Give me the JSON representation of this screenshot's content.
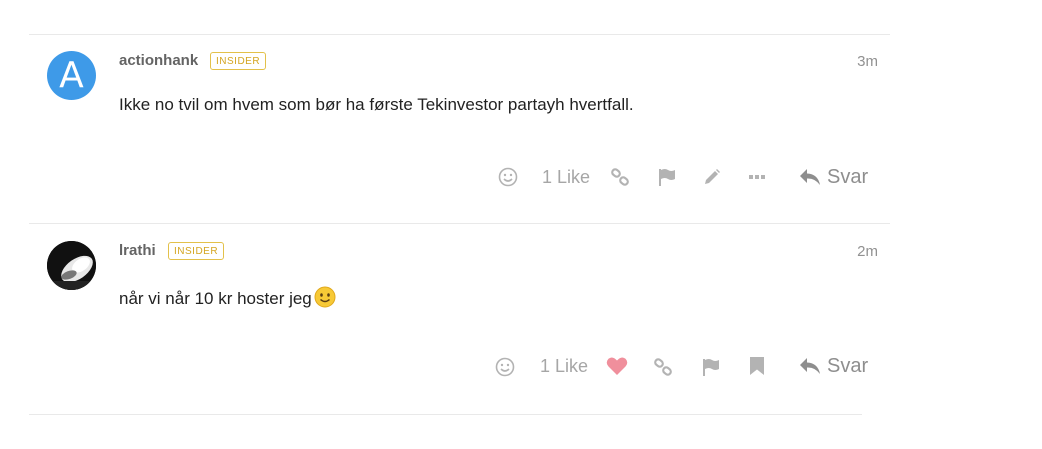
{
  "posts": [
    {
      "username": "actionhank",
      "badge": "INSIDER",
      "time": "3m",
      "avatar_letter": "A",
      "body": "Ikke no tvil om hvem som bør ha første Tekinvestor partayh hvertfall.",
      "likes": "1 Like",
      "reply_label": "Svar",
      "liked": false,
      "actions": [
        "emoji-react-icon",
        "link-icon",
        "flag-icon",
        "edit-icon",
        "more-icon"
      ]
    },
    {
      "username": "lrathi",
      "badge": "INSIDER",
      "time": "2m",
      "body": "når vi når 10 kr hoster jeg",
      "body_emoji": "slightly-smiling-face-icon",
      "likes": "1 Like",
      "reply_label": "Svar",
      "liked": true,
      "actions": [
        "emoji-react-icon",
        "heart-icon",
        "link-icon",
        "flag-icon",
        "bookmark-icon"
      ]
    }
  ],
  "colors": {
    "badge": "#d4a520",
    "heart": "#f08f9c",
    "avatar_blue": "#3e9ae8",
    "icon_gray": "#b3b3b3"
  }
}
